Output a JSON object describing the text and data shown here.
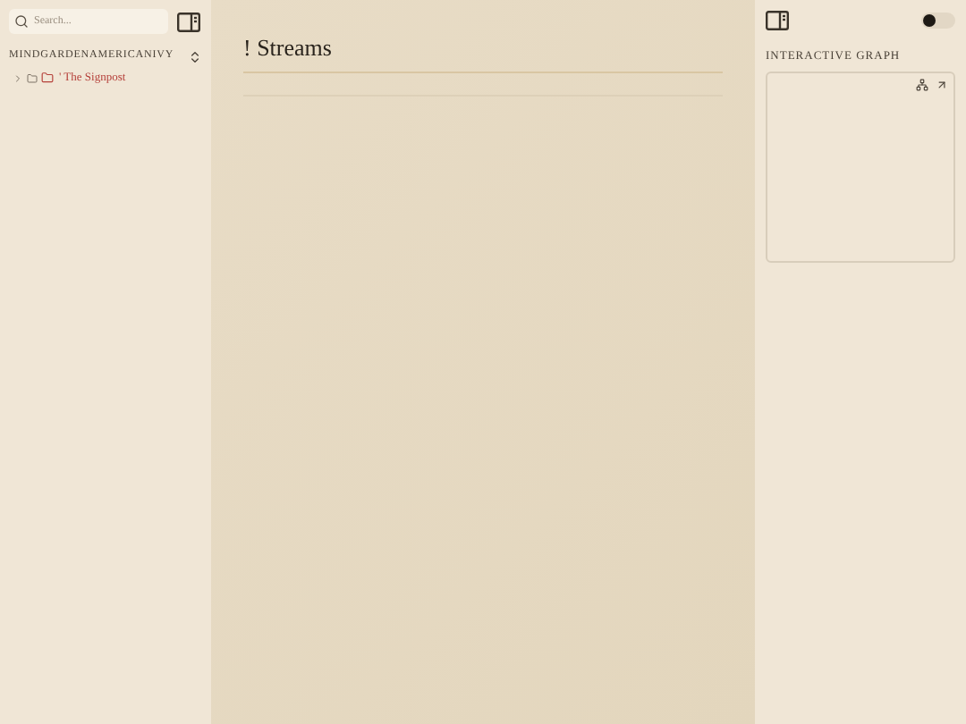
{
  "sidebar": {
    "search": {
      "placeholder": "Search..."
    },
    "vault": {
      "name": "MINDGARDENAMERICANIVY"
    },
    "tree": [
      {
        "label": "' The Signpost",
        "expanded": false
      }
    ]
  },
  "page": {
    "title": "! Streams"
  },
  "right_panel": {
    "dark_mode": false,
    "graph": {
      "title": "INTERACTIVE GRAPH"
    }
  }
}
